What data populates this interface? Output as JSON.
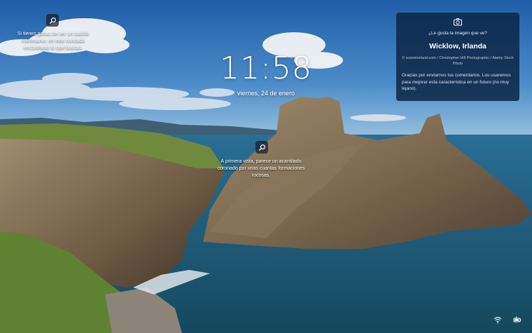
{
  "lock": {
    "time": "11:58",
    "date": "viernes, 24 de enero"
  },
  "hotspots": [
    {
      "icon": "search-icon",
      "text": "Si tienes ganas de ver un castillo interesante, en este condado encontrarás lo que buscas."
    },
    {
      "icon": "search-icon",
      "text": "A primera vista, parece un acantilado coronado por unas cuantas formaciones rocosas."
    }
  ],
  "info_card": {
    "icon": "camera-icon",
    "question": "¿Le gusta la imagen que ve?",
    "place": "Wicklow, Irlanda",
    "credit": "© sceneireland.com / Christopher Hill Photographic / Alamy Stock Photo",
    "feedback": "Gracias por enviarnos tus comentarios. Los usaremos para mejorar esta característica en un futuro (no muy lejano)."
  },
  "tray": {
    "network_icon": "wifi-icon",
    "battery_icon": "battery-icon"
  },
  "colors": {
    "card_background": "#0c2646",
    "sky": "#2d6fb0",
    "sea": "#1f5a78"
  }
}
